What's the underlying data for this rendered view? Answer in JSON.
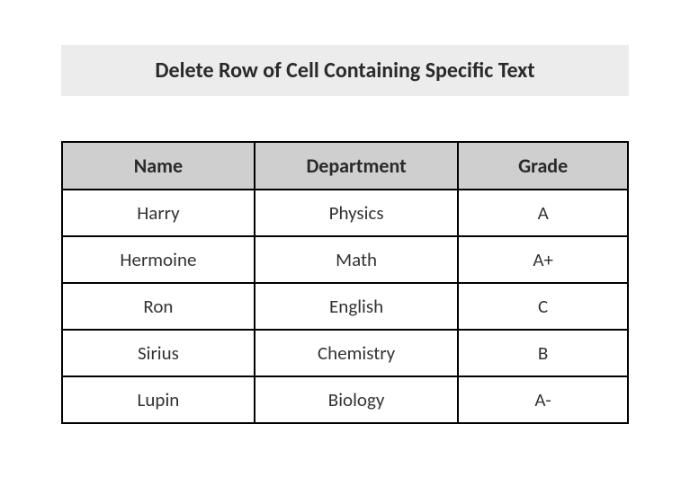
{
  "title": "Delete Row of Cell Containing Specific Text",
  "chart_data": {
    "type": "table",
    "columns": [
      "Name",
      "Department",
      "Grade"
    ],
    "rows": [
      {
        "name": "Harry",
        "department": "Physics",
        "grade": "A"
      },
      {
        "name": "Hermoine",
        "department": "Math",
        "grade": "A+"
      },
      {
        "name": "Ron",
        "department": "English",
        "grade": "C"
      },
      {
        "name": "Sirius",
        "department": "Chemistry",
        "grade": "B"
      },
      {
        "name": "Lupin",
        "department": "Biology",
        "grade": "A-"
      }
    ]
  }
}
